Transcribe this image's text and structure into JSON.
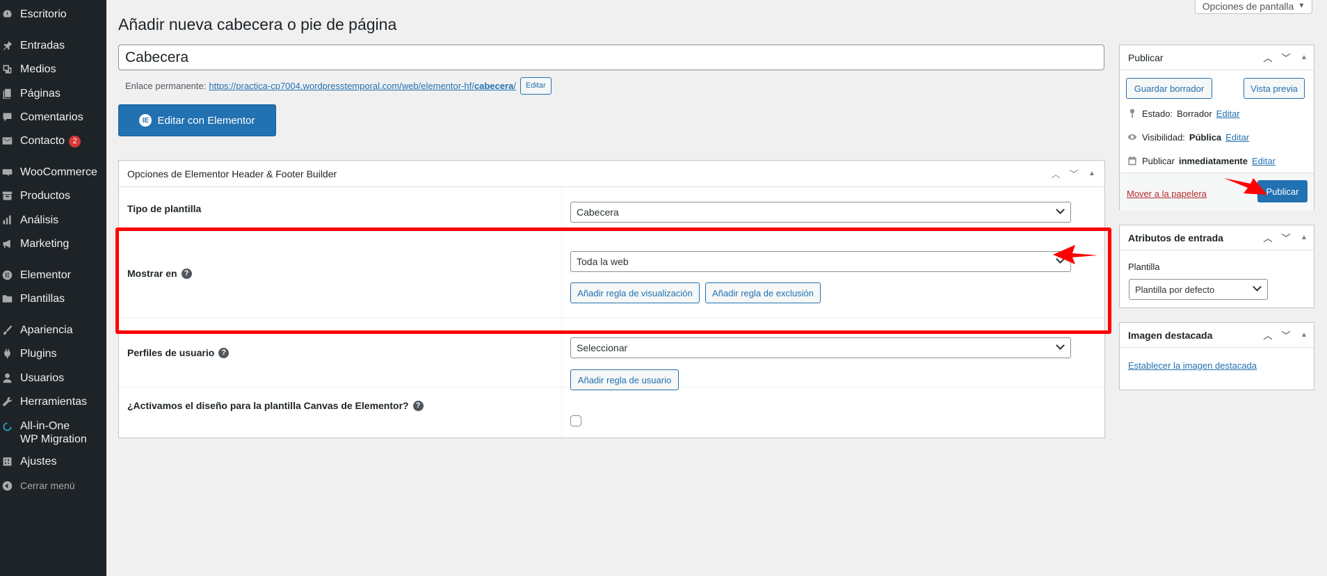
{
  "sidebar": {
    "items": [
      {
        "label": "Escritorio",
        "icon": "dashboard-icon"
      },
      {
        "label": "Entradas",
        "icon": "pin-icon"
      },
      {
        "label": "Medios",
        "icon": "media-icon"
      },
      {
        "label": "Páginas",
        "icon": "pages-icon"
      },
      {
        "label": "Comentarios",
        "icon": "comment-icon"
      },
      {
        "label": "Contacto",
        "icon": "mail-icon",
        "badge": "2"
      },
      {
        "label": "WooCommerce",
        "icon": "woo-icon"
      },
      {
        "label": "Productos",
        "icon": "archive-icon"
      },
      {
        "label": "Análisis",
        "icon": "chart-icon"
      },
      {
        "label": "Marketing",
        "icon": "megaphone-icon"
      },
      {
        "label": "Elementor",
        "icon": "elementor-icon"
      },
      {
        "label": "Plantillas",
        "icon": "folder-icon"
      },
      {
        "label": "Apariencia",
        "icon": "brush-icon"
      },
      {
        "label": "Plugins",
        "icon": "plugin-icon"
      },
      {
        "label": "Usuarios",
        "icon": "user-icon"
      },
      {
        "label": "Herramientas",
        "icon": "wrench-icon"
      },
      {
        "label": "All-in-One WP Migration",
        "icon": "migration-icon"
      },
      {
        "label": "Ajustes",
        "icon": "settings-icon"
      },
      {
        "label": "Cerrar menú",
        "icon": "collapse-icon"
      }
    ]
  },
  "screen_options": {
    "label": "Opciones de pantalla",
    "caret": "▼"
  },
  "page_title": "Añadir nueva cabecera o pie de página",
  "title_field": {
    "value": "Cabecera"
  },
  "permalink": {
    "label": "Enlace permanente:",
    "url_prefix": "https://practica-cp7004.wordpresstemporal.com/web/elementor-hf/",
    "slug": "cabecera",
    "url_suffix": "/",
    "edit_label": "Editar"
  },
  "elementor_button": {
    "label": "Editar con Elementor",
    "logo": "IE"
  },
  "options_box": {
    "title": "Opciones de Elementor Header & Footer Builder",
    "template_type": {
      "label": "Tipo de plantilla",
      "value": "Cabecera"
    },
    "display_on": {
      "label": "Mostrar en",
      "value": "Toda la web",
      "add_rule": "Añadir regla de visualización",
      "add_exclusion": "Añadir regla de exclusión"
    },
    "user_roles": {
      "label": "Perfiles de usuario",
      "value": "Seleccionar",
      "add_rule": "Añadir regla de usuario"
    },
    "canvas": {
      "label": "¿Activamos el diseño para la plantilla Canvas de Elementor?",
      "checked": false
    }
  },
  "publish_box": {
    "title": "Publicar",
    "save_draft": "Guardar borrador",
    "preview": "Vista previa",
    "status_label": "Estado:",
    "status_value": "Borrador",
    "visibility_label": "Visibilidad:",
    "visibility_value": "Pública",
    "publish_label": "Publicar",
    "publish_value": "inmediatamente",
    "edit": "Editar",
    "trash": "Mover a la papelera",
    "publish_button": "Publicar"
  },
  "attributes_box": {
    "title": "Atributos de entrada",
    "template_label": "Plantilla",
    "template_value": "Plantilla por defecto"
  },
  "featured_box": {
    "title": "Imagen destacada",
    "link": "Establecer la imagen destacada"
  },
  "colors": {
    "accent": "#2271b1",
    "sidebar": "#1d2327",
    "annotation": "#ff0000"
  }
}
